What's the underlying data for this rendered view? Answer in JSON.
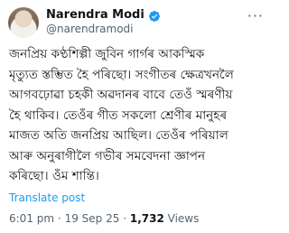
{
  "author": {
    "display_name": "Narendra Modi",
    "handle": "@narendramodi",
    "verified_color": "#1d9bf0"
  },
  "more_icon": "more-horizontal-icon",
  "tweet_lines": [
    "জনপ্ৰিয় কণ্ঠশিল্পী জুবিন গাৰ্গৰ আকস্মিক",
    "মৃত্যুত স্তম্ভিত হৈ পৰিছো। সংগীতৰ ক্ষেত্ৰখনলৈ",
    "আগবঢ়োৱা চহকী অৱদানৰ বাবে তেওঁ স্মৰণীয়",
    "হৈ থাকিব। তেওঁৰ গীত সকলো শ্ৰেণীৰ মানুহৰ",
    "মাজত অতি জনপ্ৰিয় আছিল। তেওঁৰ পৰিয়াল",
    "আৰু অনুৰাগীলৈ গভীৰ সমবেদনা জ্ঞাপন",
    "কৰিছো। ওঁম শান্তি।"
  ],
  "translate_label": "Translate post",
  "meta": {
    "time": "6:01 pm",
    "date": "19 Sep 25",
    "views_count": "1,732",
    "views_label": "Views",
    "separator": "·"
  }
}
